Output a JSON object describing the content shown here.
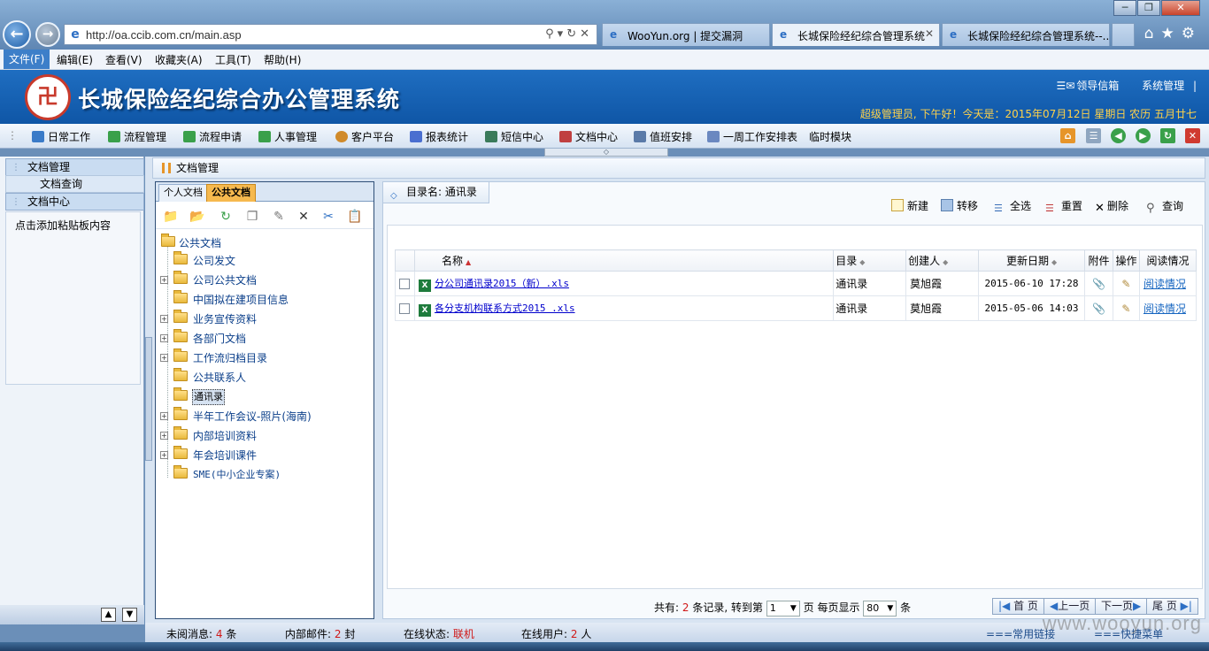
{
  "browser": {
    "url": "http://oa.ccib.com.cn/main.asp",
    "tabs": [
      {
        "label": "WooYun.org | 提交漏洞"
      },
      {
        "label": "长城保险经纪综合管理系统"
      },
      {
        "label": "长城保险经纪综合管理系统--..."
      }
    ],
    "menu": [
      "文件(F)",
      "编辑(E)",
      "查看(V)",
      "收藏夹(A)",
      "工具(T)",
      "帮助(H)"
    ]
  },
  "header": {
    "title": "长城保险经纪综合办公管理系统",
    "link_mailbox": "领导信箱",
    "link_admin": "系统管理",
    "greeting": "超级管理员, 下午好！今天是：2015年07月12日 星期日 农历 五月廿七"
  },
  "modules": [
    {
      "label": "日常工作",
      "color": "#3a7bc8"
    },
    {
      "label": "流程管理",
      "color": "#3aa04a"
    },
    {
      "label": "流程申请",
      "color": "#3aa04a"
    },
    {
      "label": "人事管理",
      "color": "#3aa04a"
    },
    {
      "label": "客户平台",
      "color": "#d08a2a"
    },
    {
      "label": "报表统计",
      "color": "#4a6fd0"
    },
    {
      "label": "短信中心",
      "color": "#3a7a5a"
    },
    {
      "label": "文档中心",
      "color": "#c04040"
    },
    {
      "label": "值班安排",
      "color": "#5a7aa8"
    },
    {
      "label": "一周工作安排表",
      "color": "#6a88c0"
    },
    {
      "label": "临时模块",
      "color": ""
    }
  ],
  "leftnav": {
    "section1": "文档管理",
    "sub1": "文档查询",
    "section2": "文档中心",
    "clipboard": "点击添加粘贴板内容"
  },
  "breadcrumb": "文档管理",
  "tree": {
    "tab_personal": "个人文档",
    "tab_public": "公共文档",
    "root": "公共文档",
    "nodes": [
      {
        "label": "公司发文",
        "expand": false
      },
      {
        "label": "公司公共文档",
        "expand": true
      },
      {
        "label": "中国拟在建项目信息",
        "expand": false
      },
      {
        "label": "业务宣传资料",
        "expand": true
      },
      {
        "label": "各部门文档",
        "expand": true
      },
      {
        "label": "工作流归档目录",
        "expand": true
      },
      {
        "label": "公共联系人",
        "expand": false
      },
      {
        "label": "通讯录",
        "expand": false,
        "selected": true
      },
      {
        "label": "半年工作会议-照片(海南)",
        "expand": true
      },
      {
        "label": "内部培训资料",
        "expand": true
      },
      {
        "label": "年会培训课件",
        "expand": true
      },
      {
        "label": "SME(中小企业专案)",
        "expand": false
      }
    ]
  },
  "docs": {
    "dir_label": "目录名: 通讯录",
    "actions": [
      "新建",
      "转移",
      "全选",
      "重置",
      "删除",
      "查询"
    ],
    "columns": [
      "名称",
      "目录",
      "创建人",
      "更新日期",
      "附件",
      "操作",
      "阅读情况"
    ],
    "rows": [
      {
        "name": "分公司通讯录2015（新）.xls",
        "dir": "通讯录",
        "creator": "莫旭霞",
        "date": "2015-06-10 17:28",
        "read": "阅读情况"
      },
      {
        "name": "各分支机构联系方式2015 .xls",
        "dir": "通讯录",
        "creator": "莫旭霞",
        "date": "2015-05-06 14:03",
        "read": "阅读情况"
      }
    ]
  },
  "pager": {
    "total_prefix": "共有:",
    "total": "2",
    "total_suffix": "条记录, 转到第",
    "page": "1",
    "page_suffix": "页 每页显示",
    "per_page": "80",
    "per_suffix": "条",
    "first": "首 页",
    "prev": "上一页",
    "next": "下一页",
    "last": "尾 页"
  },
  "status": {
    "unread_label": "未阅消息:",
    "unread": "4",
    "unread_unit": "条",
    "mail_label": "内部邮件:",
    "mail": "2",
    "mail_unit": "封",
    "online_label": "在线状态:",
    "online": "联机",
    "users_label": "在线用户:",
    "users": "2",
    "users_unit": "人",
    "links": "===常用链接",
    "menu": "===快捷菜单"
  },
  "watermark": "www.wooyun.org"
}
